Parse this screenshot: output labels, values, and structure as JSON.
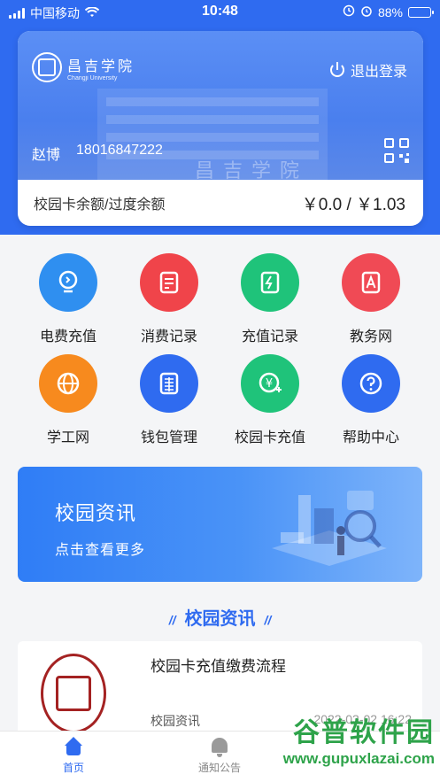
{
  "status_bar": {
    "carrier": "中国移动",
    "time": "10:48",
    "battery": "88%",
    "battery_level": 0.88
  },
  "header": {
    "school_name_cn": "昌吉学院",
    "school_name_en": "Changji University",
    "logout_label": "退出登录",
    "building_sign": "昌吉学院",
    "user_name": "赵博",
    "user_phone": "18016847222",
    "balance_label": "校园卡余额/过度余额",
    "balance_value": "￥0.0 / ￥1.03"
  },
  "grid": {
    "items": [
      {
        "label": "电费充值",
        "icon": "lightbulb-icon",
        "color": "#2f8ff0"
      },
      {
        "label": "消费记录",
        "icon": "receipt-icon",
        "color": "#f0444a"
      },
      {
        "label": "充值记录",
        "icon": "recharge-record-icon",
        "color": "#1fc37a"
      },
      {
        "label": "教务网",
        "icon": "academic-icon",
        "color": "#f04a55"
      },
      {
        "label": "学工网",
        "icon": "globe-icon",
        "color": "#f78a1e"
      },
      {
        "label": "钱包管理",
        "icon": "wallet-icon",
        "color": "#2f6bf0"
      },
      {
        "label": "校园卡充值",
        "icon": "card-recharge-icon",
        "color": "#1fc37a"
      },
      {
        "label": "帮助中心",
        "icon": "help-icon",
        "color": "#2f6bf0"
      }
    ]
  },
  "banner": {
    "title": "校园资讯",
    "subtitle": "点击查看更多"
  },
  "section": {
    "title": "校园资讯",
    "deco": "//"
  },
  "news": [
    {
      "title": "校园卡充值缴费流程",
      "category": "校园资讯",
      "date": "2022-03-02 16:22"
    }
  ],
  "tabbar": {
    "home": "首页",
    "notice": "通知公告"
  },
  "watermark": {
    "top": "谷普软件园",
    "bottom": "www.gupuxlazai.com"
  }
}
